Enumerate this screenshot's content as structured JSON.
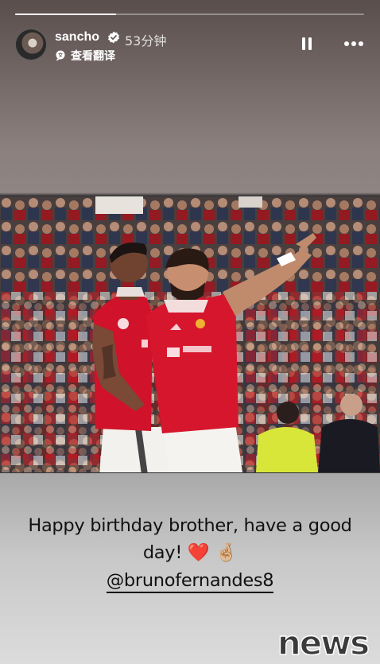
{
  "story": {
    "progress_fraction": 0.29,
    "username": "sancho",
    "time_ago": "53分钟",
    "translate_label": "查看翻译"
  },
  "caption": {
    "line1": "Happy birthday brother, have a good",
    "line2": "day! ❤️ 🤞🏼",
    "mention": "@brunofernandes8"
  },
  "watermark": {
    "text": "news"
  },
  "icons": {
    "verified": "verified-badge-icon",
    "pause": "pause-icon",
    "more": "more-options-icon",
    "translate": "translate-icon"
  },
  "colors": {
    "jersey_red": "#d0122a",
    "crowd_red": "#b3161f"
  }
}
